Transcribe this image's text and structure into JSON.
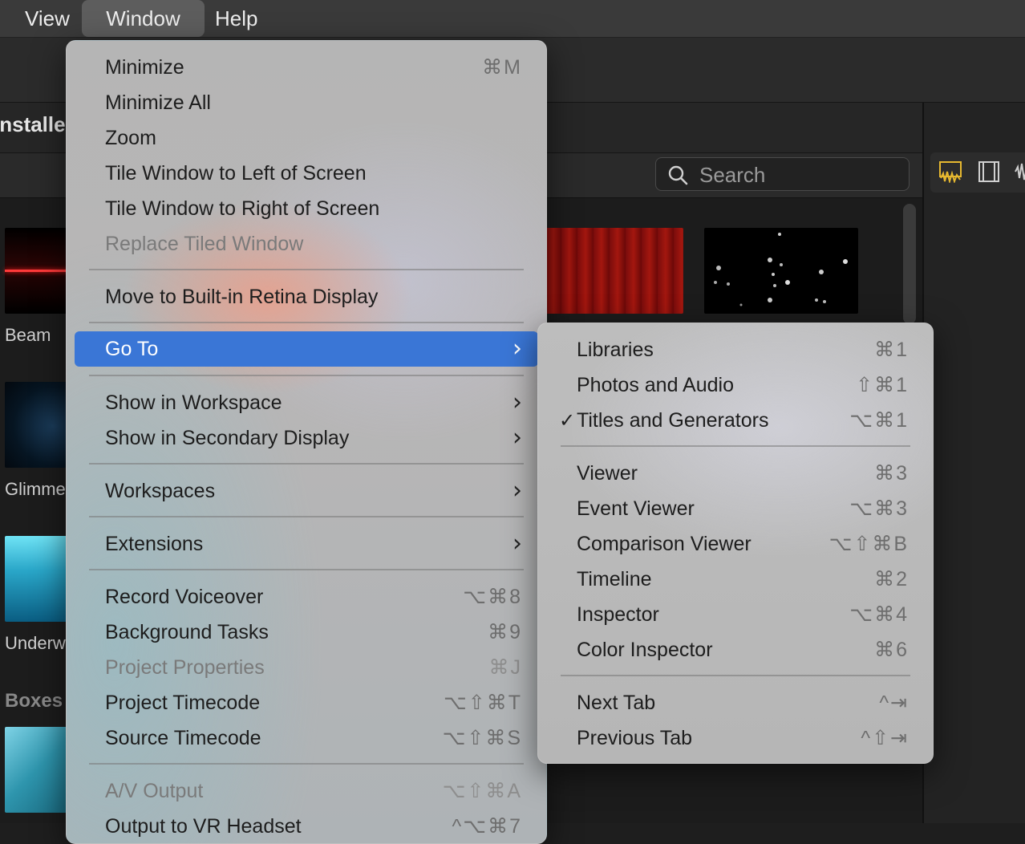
{
  "menubar": {
    "items": [
      {
        "label": "View"
      },
      {
        "label": "Window",
        "active": true
      },
      {
        "label": "Help"
      }
    ]
  },
  "app": {
    "installed_label": "Installed",
    "search_placeholder": "Search",
    "browser_labels": [
      "Beam",
      "Glimmer",
      "Underwater"
    ],
    "section_label": "Boxes"
  },
  "window_menu": {
    "items": [
      {
        "label": "Minimize",
        "shortcut": "⌘M"
      },
      {
        "label": "Minimize All",
        "shortcut": ""
      },
      {
        "label": "Zoom",
        "shortcut": ""
      },
      {
        "label": "Tile Window to Left of Screen",
        "shortcut": ""
      },
      {
        "label": "Tile Window to Right of Screen",
        "shortcut": ""
      },
      {
        "label": "Replace Tiled Window",
        "shortcut": "",
        "disabled": true
      },
      {
        "label": "Move to Built-in Retina Display",
        "shortcut": ""
      },
      {
        "label": "Go To",
        "submenu": true,
        "highlighted": true
      },
      {
        "label": "Show in Workspace",
        "submenu": true
      },
      {
        "label": "Show in Secondary Display",
        "submenu": true
      },
      {
        "label": "Workspaces",
        "submenu": true
      },
      {
        "label": "Extensions",
        "submenu": true
      },
      {
        "label": "Record Voiceover",
        "shortcut": "⌥⌘8"
      },
      {
        "label": "Background Tasks",
        "shortcut": "⌘9"
      },
      {
        "label": "Project Properties",
        "shortcut": "⌘J",
        "disabled": true
      },
      {
        "label": "Project Timecode",
        "shortcut": "⌥⇧⌘T"
      },
      {
        "label": "Source Timecode",
        "shortcut": "⌥⇧⌘S"
      },
      {
        "label": "A/V Output",
        "shortcut": "⌥⇧⌘A",
        "disabled": true
      },
      {
        "label": "Output to VR Headset",
        "shortcut": "^⌥⌘7"
      }
    ]
  },
  "goto_submenu": {
    "items": [
      {
        "label": "Libraries",
        "shortcut": "⌘1"
      },
      {
        "label": "Photos and Audio",
        "shortcut": "⇧⌘1"
      },
      {
        "label": "Titles and Generators",
        "shortcut": "⌥⌘1",
        "checked": true
      },
      {
        "label": "Viewer",
        "shortcut": "⌘3"
      },
      {
        "label": "Event Viewer",
        "shortcut": "⌥⌘3"
      },
      {
        "label": "Comparison Viewer",
        "shortcut": "⌥⇧⌘B"
      },
      {
        "label": "Timeline",
        "shortcut": "⌘2"
      },
      {
        "label": "Inspector",
        "shortcut": "⌥⌘4"
      },
      {
        "label": "Color Inspector",
        "shortcut": "⌘6"
      },
      {
        "label": "Next Tab",
        "shortcut": "^⇥"
      },
      {
        "label": "Previous Tab",
        "shortcut": "^⇧⇥"
      }
    ]
  },
  "colors": {
    "highlight": "#3a76d6",
    "menubar": "#3a3a3a"
  }
}
